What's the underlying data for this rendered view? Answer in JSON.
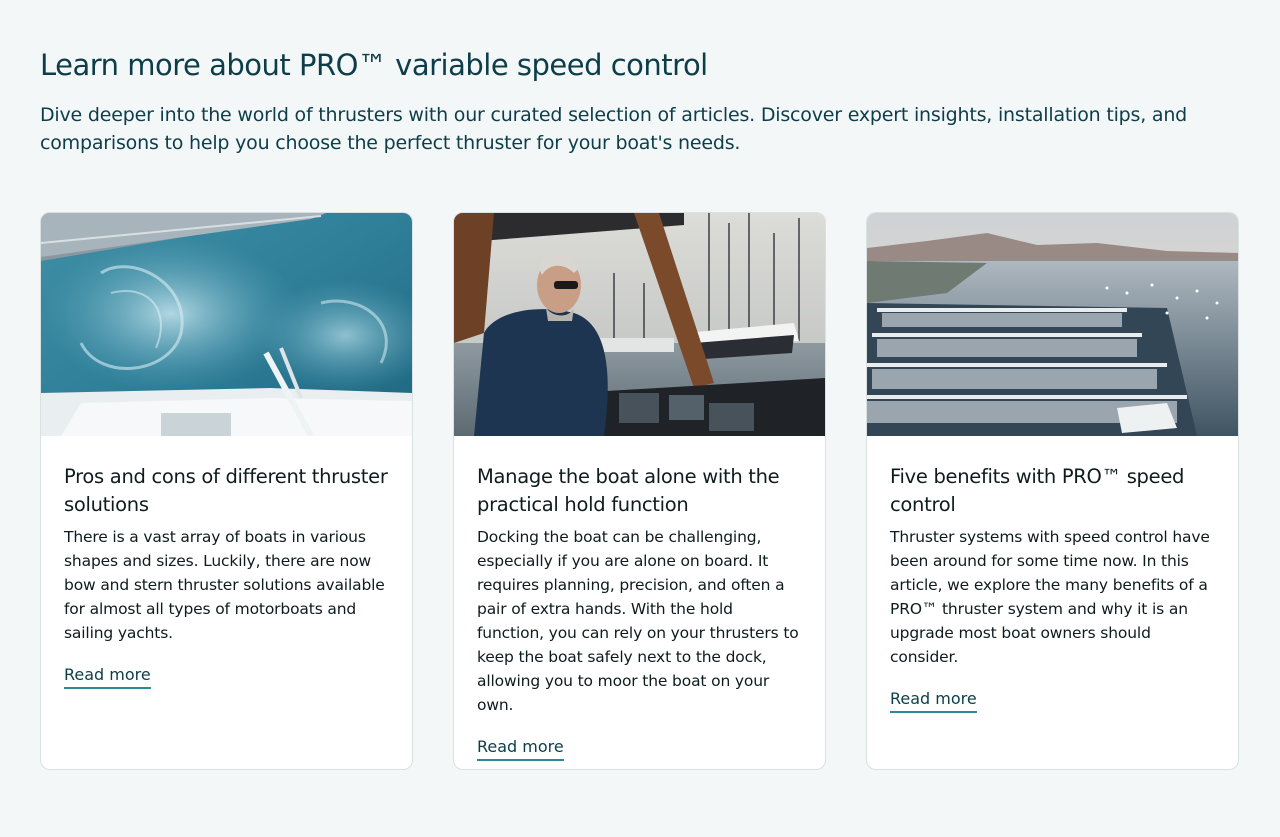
{
  "section": {
    "title": "Learn more about PRO™ variable speed control",
    "intro": "Dive deeper into the world of thrusters with our curated selection of articles. Discover expert insights, installation tips, and comparisons to help you choose the perfect thruster for your boat's needs."
  },
  "cards": [
    {
      "image": "aerial-boat-wake-photo",
      "title": "Pros and cons of different thruster solutions",
      "text": "There is a vast array of boats in various shapes and sizes. Luckily, there are now bow and stern thruster solutions available for almost all types of motorboats and sailing yachts.",
      "link": "Read more"
    },
    {
      "image": "man-at-helm-marina-photo",
      "title": "Manage the boat alone with the practical hold function",
      "text": "Docking the boat can be challenging, especially if you are alone on board. It requires planning, precision, and often a pair of extra hands. With the hold function, you can rely on your thrusters to keep the boat safely next to the dock, allowing you to moor the boat on your own.",
      "link": "Read more"
    },
    {
      "image": "aerial-marina-photo",
      "title": "Five benefits with PRO™ speed control",
      "text": "Thruster systems with speed control have been around for some time now. In this article, we explore the many benefits of a PRO™ thruster system and why it is an upgrade most boat owners should consider.",
      "link": "Read more"
    }
  ],
  "colors": {
    "heading": "#0c3d48",
    "link_underline": "#2a8a93",
    "background": "#f3f7f8"
  }
}
